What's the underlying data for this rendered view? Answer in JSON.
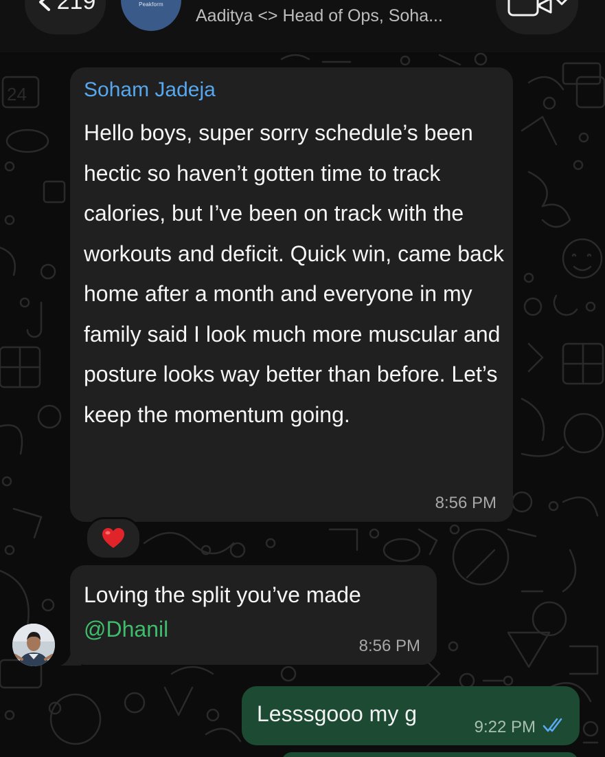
{
  "header": {
    "back_count": "219",
    "group_logo_text": "Peakform",
    "subtitle": "Aaditya <> Head of Ops, Soha...",
    "back_icon": "chevron-left-icon",
    "video_icon": "video-camera-icon"
  },
  "messages": [
    {
      "sender": "Soham Jadeja",
      "text": "Hello boys, super sorry schedule’s been hectic so haven’t gotten time to track calories, but I’ve been on track with the workouts and deficit. Quick win, came back home after a month and everyone in my family said I look much more muscular and posture looks way better than before. Let’s keep the momentum going.",
      "time": "8:56 PM",
      "reaction": "❤️"
    },
    {
      "text_line1": "Loving the split you’ve made",
      "mention": "@Dhanil",
      "time": "8:56 PM"
    },
    {
      "text": "Lesssgooo my g",
      "time": "9:22 PM",
      "status_icon": "double-check-read-icon"
    }
  ],
  "colors": {
    "incoming_bubble": "#202020",
    "outgoing_bubble": "#1c4a33",
    "sender_name": "#57a7ee",
    "mention": "#3fbd6c",
    "read_ticks": "#5aa9f0"
  }
}
